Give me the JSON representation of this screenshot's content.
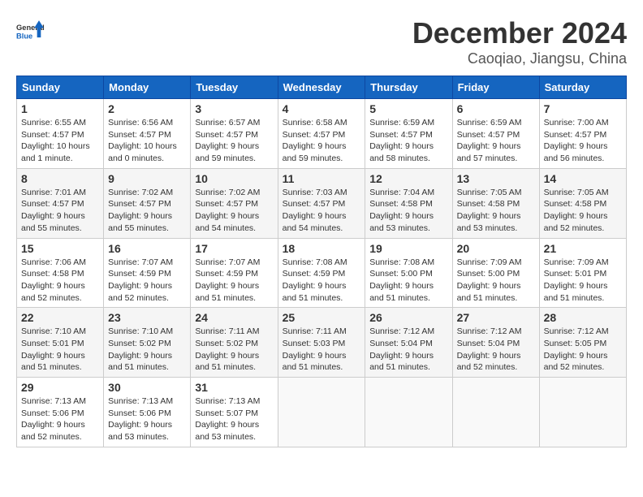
{
  "header": {
    "logo_general": "General",
    "logo_blue": "Blue",
    "month": "December 2024",
    "location": "Caoqiao, Jiangsu, China"
  },
  "columns": [
    "Sunday",
    "Monday",
    "Tuesday",
    "Wednesday",
    "Thursday",
    "Friday",
    "Saturday"
  ],
  "weeks": [
    [
      {
        "day": "1",
        "sunrise": "Sunrise: 6:55 AM",
        "sunset": "Sunset: 4:57 PM",
        "daylight": "Daylight: 10 hours and 1 minute."
      },
      {
        "day": "2",
        "sunrise": "Sunrise: 6:56 AM",
        "sunset": "Sunset: 4:57 PM",
        "daylight": "Daylight: 10 hours and 0 minutes."
      },
      {
        "day": "3",
        "sunrise": "Sunrise: 6:57 AM",
        "sunset": "Sunset: 4:57 PM",
        "daylight": "Daylight: 9 hours and 59 minutes."
      },
      {
        "day": "4",
        "sunrise": "Sunrise: 6:58 AM",
        "sunset": "Sunset: 4:57 PM",
        "daylight": "Daylight: 9 hours and 59 minutes."
      },
      {
        "day": "5",
        "sunrise": "Sunrise: 6:59 AM",
        "sunset": "Sunset: 4:57 PM",
        "daylight": "Daylight: 9 hours and 58 minutes."
      },
      {
        "day": "6",
        "sunrise": "Sunrise: 6:59 AM",
        "sunset": "Sunset: 4:57 PM",
        "daylight": "Daylight: 9 hours and 57 minutes."
      },
      {
        "day": "7",
        "sunrise": "Sunrise: 7:00 AM",
        "sunset": "Sunset: 4:57 PM",
        "daylight": "Daylight: 9 hours and 56 minutes."
      }
    ],
    [
      {
        "day": "8",
        "sunrise": "Sunrise: 7:01 AM",
        "sunset": "Sunset: 4:57 PM",
        "daylight": "Daylight: 9 hours and 55 minutes."
      },
      {
        "day": "9",
        "sunrise": "Sunrise: 7:02 AM",
        "sunset": "Sunset: 4:57 PM",
        "daylight": "Daylight: 9 hours and 55 minutes."
      },
      {
        "day": "10",
        "sunrise": "Sunrise: 7:02 AM",
        "sunset": "Sunset: 4:57 PM",
        "daylight": "Daylight: 9 hours and 54 minutes."
      },
      {
        "day": "11",
        "sunrise": "Sunrise: 7:03 AM",
        "sunset": "Sunset: 4:57 PM",
        "daylight": "Daylight: 9 hours and 54 minutes."
      },
      {
        "day": "12",
        "sunrise": "Sunrise: 7:04 AM",
        "sunset": "Sunset: 4:58 PM",
        "daylight": "Daylight: 9 hours and 53 minutes."
      },
      {
        "day": "13",
        "sunrise": "Sunrise: 7:05 AM",
        "sunset": "Sunset: 4:58 PM",
        "daylight": "Daylight: 9 hours and 53 minutes."
      },
      {
        "day": "14",
        "sunrise": "Sunrise: 7:05 AM",
        "sunset": "Sunset: 4:58 PM",
        "daylight": "Daylight: 9 hours and 52 minutes."
      }
    ],
    [
      {
        "day": "15",
        "sunrise": "Sunrise: 7:06 AM",
        "sunset": "Sunset: 4:58 PM",
        "daylight": "Daylight: 9 hours and 52 minutes."
      },
      {
        "day": "16",
        "sunrise": "Sunrise: 7:07 AM",
        "sunset": "Sunset: 4:59 PM",
        "daylight": "Daylight: 9 hours and 52 minutes."
      },
      {
        "day": "17",
        "sunrise": "Sunrise: 7:07 AM",
        "sunset": "Sunset: 4:59 PM",
        "daylight": "Daylight: 9 hours and 51 minutes."
      },
      {
        "day": "18",
        "sunrise": "Sunrise: 7:08 AM",
        "sunset": "Sunset: 4:59 PM",
        "daylight": "Daylight: 9 hours and 51 minutes."
      },
      {
        "day": "19",
        "sunrise": "Sunrise: 7:08 AM",
        "sunset": "Sunset: 5:00 PM",
        "daylight": "Daylight: 9 hours and 51 minutes."
      },
      {
        "day": "20",
        "sunrise": "Sunrise: 7:09 AM",
        "sunset": "Sunset: 5:00 PM",
        "daylight": "Daylight: 9 hours and 51 minutes."
      },
      {
        "day": "21",
        "sunrise": "Sunrise: 7:09 AM",
        "sunset": "Sunset: 5:01 PM",
        "daylight": "Daylight: 9 hours and 51 minutes."
      }
    ],
    [
      {
        "day": "22",
        "sunrise": "Sunrise: 7:10 AM",
        "sunset": "Sunset: 5:01 PM",
        "daylight": "Daylight: 9 hours and 51 minutes."
      },
      {
        "day": "23",
        "sunrise": "Sunrise: 7:10 AM",
        "sunset": "Sunset: 5:02 PM",
        "daylight": "Daylight: 9 hours and 51 minutes."
      },
      {
        "day": "24",
        "sunrise": "Sunrise: 7:11 AM",
        "sunset": "Sunset: 5:02 PM",
        "daylight": "Daylight: 9 hours and 51 minutes."
      },
      {
        "day": "25",
        "sunrise": "Sunrise: 7:11 AM",
        "sunset": "Sunset: 5:03 PM",
        "daylight": "Daylight: 9 hours and 51 minutes."
      },
      {
        "day": "26",
        "sunrise": "Sunrise: 7:12 AM",
        "sunset": "Sunset: 5:04 PM",
        "daylight": "Daylight: 9 hours and 51 minutes."
      },
      {
        "day": "27",
        "sunrise": "Sunrise: 7:12 AM",
        "sunset": "Sunset: 5:04 PM",
        "daylight": "Daylight: 9 hours and 52 minutes."
      },
      {
        "day": "28",
        "sunrise": "Sunrise: 7:12 AM",
        "sunset": "Sunset: 5:05 PM",
        "daylight": "Daylight: 9 hours and 52 minutes."
      }
    ],
    [
      {
        "day": "29",
        "sunrise": "Sunrise: 7:13 AM",
        "sunset": "Sunset: 5:06 PM",
        "daylight": "Daylight: 9 hours and 52 minutes."
      },
      {
        "day": "30",
        "sunrise": "Sunrise: 7:13 AM",
        "sunset": "Sunset: 5:06 PM",
        "daylight": "Daylight: 9 hours and 53 minutes."
      },
      {
        "day": "31",
        "sunrise": "Sunrise: 7:13 AM",
        "sunset": "Sunset: 5:07 PM",
        "daylight": "Daylight: 9 hours and 53 minutes."
      },
      null,
      null,
      null,
      null
    ]
  ]
}
